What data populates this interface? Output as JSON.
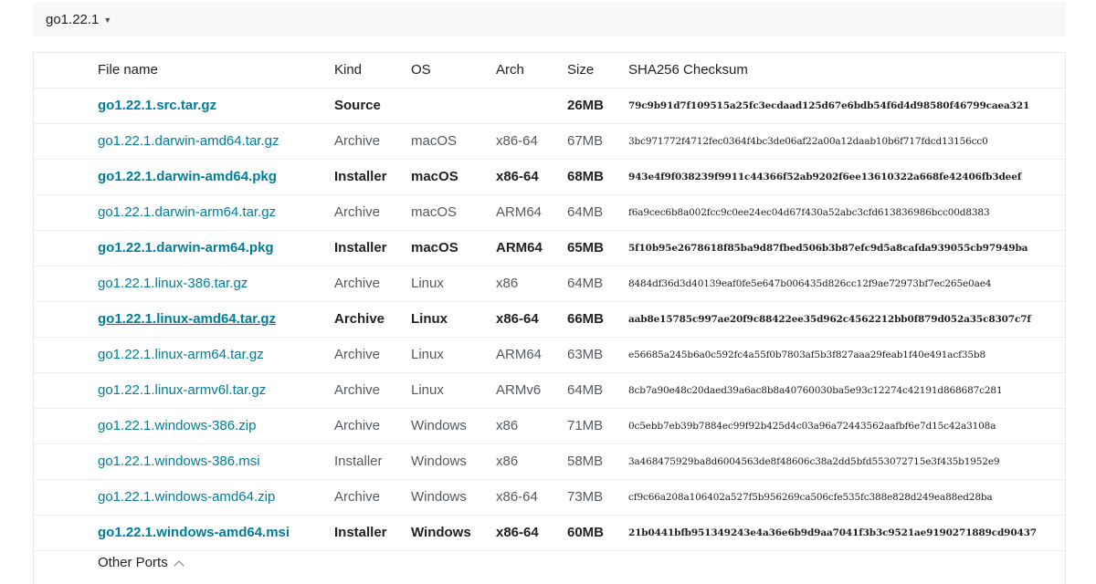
{
  "version_selector": {
    "label": "go1.22.1"
  },
  "table": {
    "headers": [
      "File name",
      "Kind",
      "OS",
      "Arch",
      "Size",
      "SHA256 Checksum"
    ],
    "rows": [
      {
        "name": "go1.22.1.src.tar.gz",
        "kind": "Source",
        "os": "",
        "arch": "",
        "size": "26MB",
        "sha": "79c9b91d7f109515a25fc3ecdaad125d67e6bdb54f6d4d98580f46799caea321",
        "featured": true
      },
      {
        "name": "go1.22.1.darwin-amd64.tar.gz",
        "kind": "Archive",
        "os": "macOS",
        "arch": "x86-64",
        "size": "67MB",
        "sha": "3bc971772f4712fec0364f4bc3de06af22a00a12daab10b6f717fdcd13156cc0",
        "featured": false
      },
      {
        "name": "go1.22.1.darwin-amd64.pkg",
        "kind": "Installer",
        "os": "macOS",
        "arch": "x86-64",
        "size": "68MB",
        "sha": "943e4f9f038239f9911c44366f52ab9202f6ee13610322a668fe42406fb3deef",
        "featured": true
      },
      {
        "name": "go1.22.1.darwin-arm64.tar.gz",
        "kind": "Archive",
        "os": "macOS",
        "arch": "ARM64",
        "size": "64MB",
        "sha": "f6a9cec6b8a002fcc9c0ee24ec04d67f430a52abc3cfd613836986bcc00d8383",
        "featured": false
      },
      {
        "name": "go1.22.1.darwin-arm64.pkg",
        "kind": "Installer",
        "os": "macOS",
        "arch": "ARM64",
        "size": "65MB",
        "sha": "5f10b95e2678618f85ba9d87fbed506b3b87efc9d5a8cafda939055cb97949ba",
        "featured": true
      },
      {
        "name": "go1.22.1.linux-386.tar.gz",
        "kind": "Archive",
        "os": "Linux",
        "arch": "x86",
        "size": "64MB",
        "sha": "8484df36d3d40139eaf0fe5e647b006435d826cc12f9ae72973bf7ec265e0ae4",
        "featured": false
      },
      {
        "name": "go1.22.1.linux-amd64.tar.gz",
        "kind": "Archive",
        "os": "Linux",
        "arch": "x86-64",
        "size": "66MB",
        "sha": "aab8e15785c997ae20f9c88422ee35d962c4562212bb0f879d052a35c8307c7f",
        "featured": true,
        "hovered": true
      },
      {
        "name": "go1.22.1.linux-arm64.tar.gz",
        "kind": "Archive",
        "os": "Linux",
        "arch": "ARM64",
        "size": "63MB",
        "sha": "e56685a245b6a0c592fc4a55f0b7803af5b3f827aaa29feab1f40e491acf35b8",
        "featured": false
      },
      {
        "name": "go1.22.1.linux-armv6l.tar.gz",
        "kind": "Archive",
        "os": "Linux",
        "arch": "ARMv6",
        "size": "64MB",
        "sha": "8cb7a90e48c20daed39a6ac8b8a40760030ba5e93c12274c42191d868687c281",
        "featured": false
      },
      {
        "name": "go1.22.1.windows-386.zip",
        "kind": "Archive",
        "os": "Windows",
        "arch": "x86",
        "size": "71MB",
        "sha": "0c5ebb7eb39b7884ec99f92b425d4c03a96a72443562aafbf6e7d15c42a3108a",
        "featured": false
      },
      {
        "name": "go1.22.1.windows-386.msi",
        "kind": "Installer",
        "os": "Windows",
        "arch": "x86",
        "size": "58MB",
        "sha": "3a468475929ba8d6004563de8f48606c38a2dd5bfd553072715e3f435b1952e9",
        "featured": false
      },
      {
        "name": "go1.22.1.windows-amd64.zip",
        "kind": "Archive",
        "os": "Windows",
        "arch": "x86-64",
        "size": "73MB",
        "sha": "cf9c66a208a106402a527f5b956269ca506cfe535fc388e828d249ea88ed28ba",
        "featured": false
      },
      {
        "name": "go1.22.1.windows-amd64.msi",
        "kind": "Installer",
        "os": "Windows",
        "arch": "x86-64",
        "size": "60MB",
        "sha": "21b0441bfb951349243e4a36e6b9d9aa7041f3b3c9521ae9190271889cd90437",
        "featured": true
      }
    ]
  },
  "other_ports": {
    "label": "Other Ports"
  }
}
